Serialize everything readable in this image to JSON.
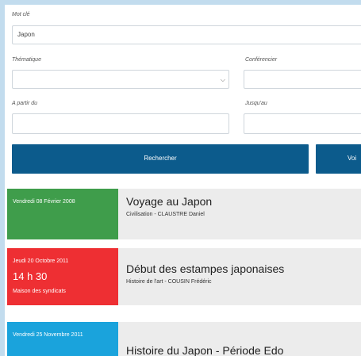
{
  "search": {
    "keyword_label": "Mot clé",
    "keyword_value": "Japon",
    "theme_label": "Thématique",
    "theme_value": "",
    "speaker_label": "Conférencier",
    "speaker_value": "",
    "from_label": "A partir du",
    "from_value": "",
    "until_label": "Jusqu'au",
    "until_value": "",
    "search_button": "Rechercher",
    "second_button": "Voi"
  },
  "results": [
    {
      "date": "Vendredi 08 Février 2008",
      "time": "",
      "place": "",
      "title": "Voyage au Japon",
      "subtitle": "Civilisation - CLAUSTRE Daniel",
      "color": "#3f9d4b"
    },
    {
      "date": "Jeudi 20 Octobre 2011",
      "time": "14 h 30",
      "place": "Maison des syndicats",
      "title": "Début des estampes japonaises",
      "subtitle": "Histoire de l'art - COUSIN Frédéric",
      "color": "#ee2f33"
    },
    {
      "date": "Vendredi 25 Novembre 2011",
      "time": "",
      "place": "",
      "title": "Histoire du Japon - Période Edo",
      "subtitle": "",
      "color": "#1aa3dc"
    }
  ],
  "colors": {
    "page_background": "#c2dcee",
    "button": "#0c5b8c",
    "card_background": "#ececec"
  }
}
